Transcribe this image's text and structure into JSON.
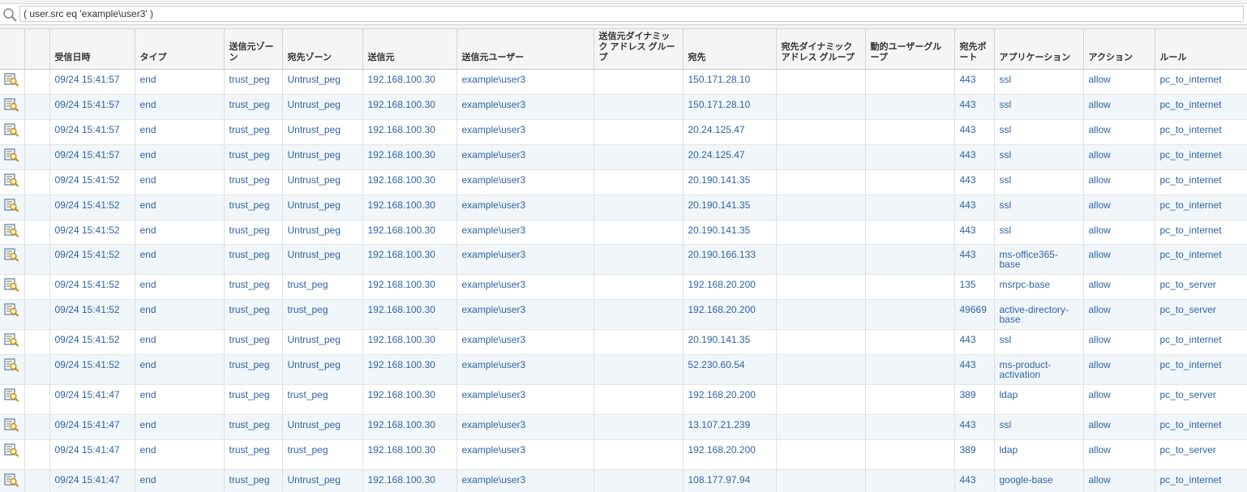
{
  "filter": {
    "query": "( user.src eq 'example\\user3' )"
  },
  "columns": [
    {
      "key": "icon",
      "label": ""
    },
    {
      "key": "blank",
      "label": ""
    },
    {
      "key": "time",
      "label": "受信日時"
    },
    {
      "key": "type",
      "label": "タイプ"
    },
    {
      "key": "src_zone",
      "label": "送信元ゾーン"
    },
    {
      "key": "dst_zone",
      "label": "宛先ゾーン"
    },
    {
      "key": "src",
      "label": "送信元"
    },
    {
      "key": "src_user",
      "label": "送信元ユーザー"
    },
    {
      "key": "src_dag",
      "label": "送信元ダイナミック アドレス グループ"
    },
    {
      "key": "dst",
      "label": "宛先"
    },
    {
      "key": "dst_dag",
      "label": "宛先ダイナミック アドレス グループ"
    },
    {
      "key": "dug",
      "label": "動的ユーザーグループ"
    },
    {
      "key": "dst_port",
      "label": "宛先ポート"
    },
    {
      "key": "app",
      "label": "アプリケーション"
    },
    {
      "key": "action",
      "label": "アクション"
    },
    {
      "key": "rule",
      "label": "ルール"
    }
  ],
  "rows": [
    {
      "time": "09/24 15:41:57",
      "type": "end",
      "src_zone": "trust_peg",
      "dst_zone": "Untrust_peg",
      "src": "192.168.100.30",
      "src_user": "example\\user3",
      "src_dag": "",
      "dst": "150.171.28.10",
      "dst_dag": "",
      "dug": "",
      "dst_port": "443",
      "app": "ssl",
      "action": "allow",
      "rule": "pc_to_internet"
    },
    {
      "time": "09/24 15:41:57",
      "type": "end",
      "src_zone": "trust_peg",
      "dst_zone": "Untrust_peg",
      "src": "192.168.100.30",
      "src_user": "example\\user3",
      "src_dag": "",
      "dst": "150.171.28.10",
      "dst_dag": "",
      "dug": "",
      "dst_port": "443",
      "app": "ssl",
      "action": "allow",
      "rule": "pc_to_internet"
    },
    {
      "time": "09/24 15:41:57",
      "type": "end",
      "src_zone": "trust_peg",
      "dst_zone": "Untrust_peg",
      "src": "192.168.100.30",
      "src_user": "example\\user3",
      "src_dag": "",
      "dst": "20.24.125.47",
      "dst_dag": "",
      "dug": "",
      "dst_port": "443",
      "app": "ssl",
      "action": "allow",
      "rule": "pc_to_internet"
    },
    {
      "time": "09/24 15:41:57",
      "type": "end",
      "src_zone": "trust_peg",
      "dst_zone": "Untrust_peg",
      "src": "192.168.100.30",
      "src_user": "example\\user3",
      "src_dag": "",
      "dst": "20.24.125.47",
      "dst_dag": "",
      "dug": "",
      "dst_port": "443",
      "app": "ssl",
      "action": "allow",
      "rule": "pc_to_internet"
    },
    {
      "time": "09/24 15:41:52",
      "type": "end",
      "src_zone": "trust_peg",
      "dst_zone": "Untrust_peg",
      "src": "192.168.100.30",
      "src_user": "example\\user3",
      "src_dag": "",
      "dst": "20.190.141.35",
      "dst_dag": "",
      "dug": "",
      "dst_port": "443",
      "app": "ssl",
      "action": "allow",
      "rule": "pc_to_internet"
    },
    {
      "time": "09/24 15:41:52",
      "type": "end",
      "src_zone": "trust_peg",
      "dst_zone": "Untrust_peg",
      "src": "192.168.100.30",
      "src_user": "example\\user3",
      "src_dag": "",
      "dst": "20.190.141.35",
      "dst_dag": "",
      "dug": "",
      "dst_port": "443",
      "app": "ssl",
      "action": "allow",
      "rule": "pc_to_internet"
    },
    {
      "time": "09/24 15:41:52",
      "type": "end",
      "src_zone": "trust_peg",
      "dst_zone": "Untrust_peg",
      "src": "192.168.100.30",
      "src_user": "example\\user3",
      "src_dag": "",
      "dst": "20.190.141.35",
      "dst_dag": "",
      "dug": "",
      "dst_port": "443",
      "app": "ssl",
      "action": "allow",
      "rule": "pc_to_internet"
    },
    {
      "time": "09/24 15:41:52",
      "type": "end",
      "src_zone": "trust_peg",
      "dst_zone": "Untrust_peg",
      "src": "192.168.100.30",
      "src_user": "example\\user3",
      "src_dag": "",
      "dst": "20.190.166.133",
      "dst_dag": "",
      "dug": "",
      "dst_port": "443",
      "app": "ms-office365-base",
      "action": "allow",
      "rule": "pc_to_internet"
    },
    {
      "time": "09/24 15:41:52",
      "type": "end",
      "src_zone": "trust_peg",
      "dst_zone": "trust_peg",
      "src": "192.168.100.30",
      "src_user": "example\\user3",
      "src_dag": "",
      "dst": "192.168.20.200",
      "dst_dag": "",
      "dug": "",
      "dst_port": "135",
      "app": "msrpc-base",
      "action": "allow",
      "rule": "pc_to_server"
    },
    {
      "time": "09/24 15:41:52",
      "type": "end",
      "src_zone": "trust_peg",
      "dst_zone": "trust_peg",
      "src": "192.168.100.30",
      "src_user": "example\\user3",
      "src_dag": "",
      "dst": "192.168.20.200",
      "dst_dag": "",
      "dug": "",
      "dst_port": "49669",
      "app": "active-directory-base",
      "action": "allow",
      "rule": "pc_to_server"
    },
    {
      "time": "09/24 15:41:52",
      "type": "end",
      "src_zone": "trust_peg",
      "dst_zone": "Untrust_peg",
      "src": "192.168.100.30",
      "src_user": "example\\user3",
      "src_dag": "",
      "dst": "20.190.141.35",
      "dst_dag": "",
      "dug": "",
      "dst_port": "443",
      "app": "ssl",
      "action": "allow",
      "rule": "pc_to_internet"
    },
    {
      "time": "09/24 15:41:52",
      "type": "end",
      "src_zone": "trust_peg",
      "dst_zone": "Untrust_peg",
      "src": "192.168.100.30",
      "src_user": "example\\user3",
      "src_dag": "",
      "dst": "52.230.60.54",
      "dst_dag": "",
      "dug": "",
      "dst_port": "443",
      "app": "ms-product-activation",
      "action": "allow",
      "rule": "pc_to_internet"
    },
    {
      "time": "09/24 15:41:47",
      "type": "end",
      "src_zone": "trust_peg",
      "dst_zone": "trust_peg",
      "src": "192.168.100.30",
      "src_user": "example\\user3",
      "src_dag": "",
      "dst": "192.168.20.200",
      "dst_dag": "",
      "dug": "",
      "dst_port": "389",
      "app": "ldap",
      "action": "allow",
      "rule": "pc_to_server"
    },
    {
      "time": "09/24 15:41:47",
      "type": "end",
      "src_zone": "trust_peg",
      "dst_zone": "Untrust_peg",
      "src": "192.168.100.30",
      "src_user": "example\\user3",
      "src_dag": "",
      "dst": "13.107.21.239",
      "dst_dag": "",
      "dug": "",
      "dst_port": "443",
      "app": "ssl",
      "action": "allow",
      "rule": "pc_to_internet"
    },
    {
      "time": "09/24 15:41:47",
      "type": "end",
      "src_zone": "trust_peg",
      "dst_zone": "trust_peg",
      "src": "192.168.100.30",
      "src_user": "example\\user3",
      "src_dag": "",
      "dst": "192.168.20.200",
      "dst_dag": "",
      "dug": "",
      "dst_port": "389",
      "app": "ldap",
      "action": "allow",
      "rule": "pc_to_server"
    },
    {
      "time": "09/24 15:41:47",
      "type": "end",
      "src_zone": "trust_peg",
      "dst_zone": "Untrust_peg",
      "src": "192.168.100.30",
      "src_user": "example\\user3",
      "src_dag": "",
      "dst": "108.177.97.94",
      "dst_dag": "",
      "dug": "",
      "dst_port": "443",
      "app": "google-base",
      "action": "allow",
      "rule": "pc_to_internet"
    }
  ],
  "icons": {
    "search": "search-icon",
    "row_detail": "log-detail-icon"
  },
  "colors": {
    "link": "#2f64a8",
    "row_alt": "#f0f6f9",
    "header_bg": "#f5f5f5"
  }
}
